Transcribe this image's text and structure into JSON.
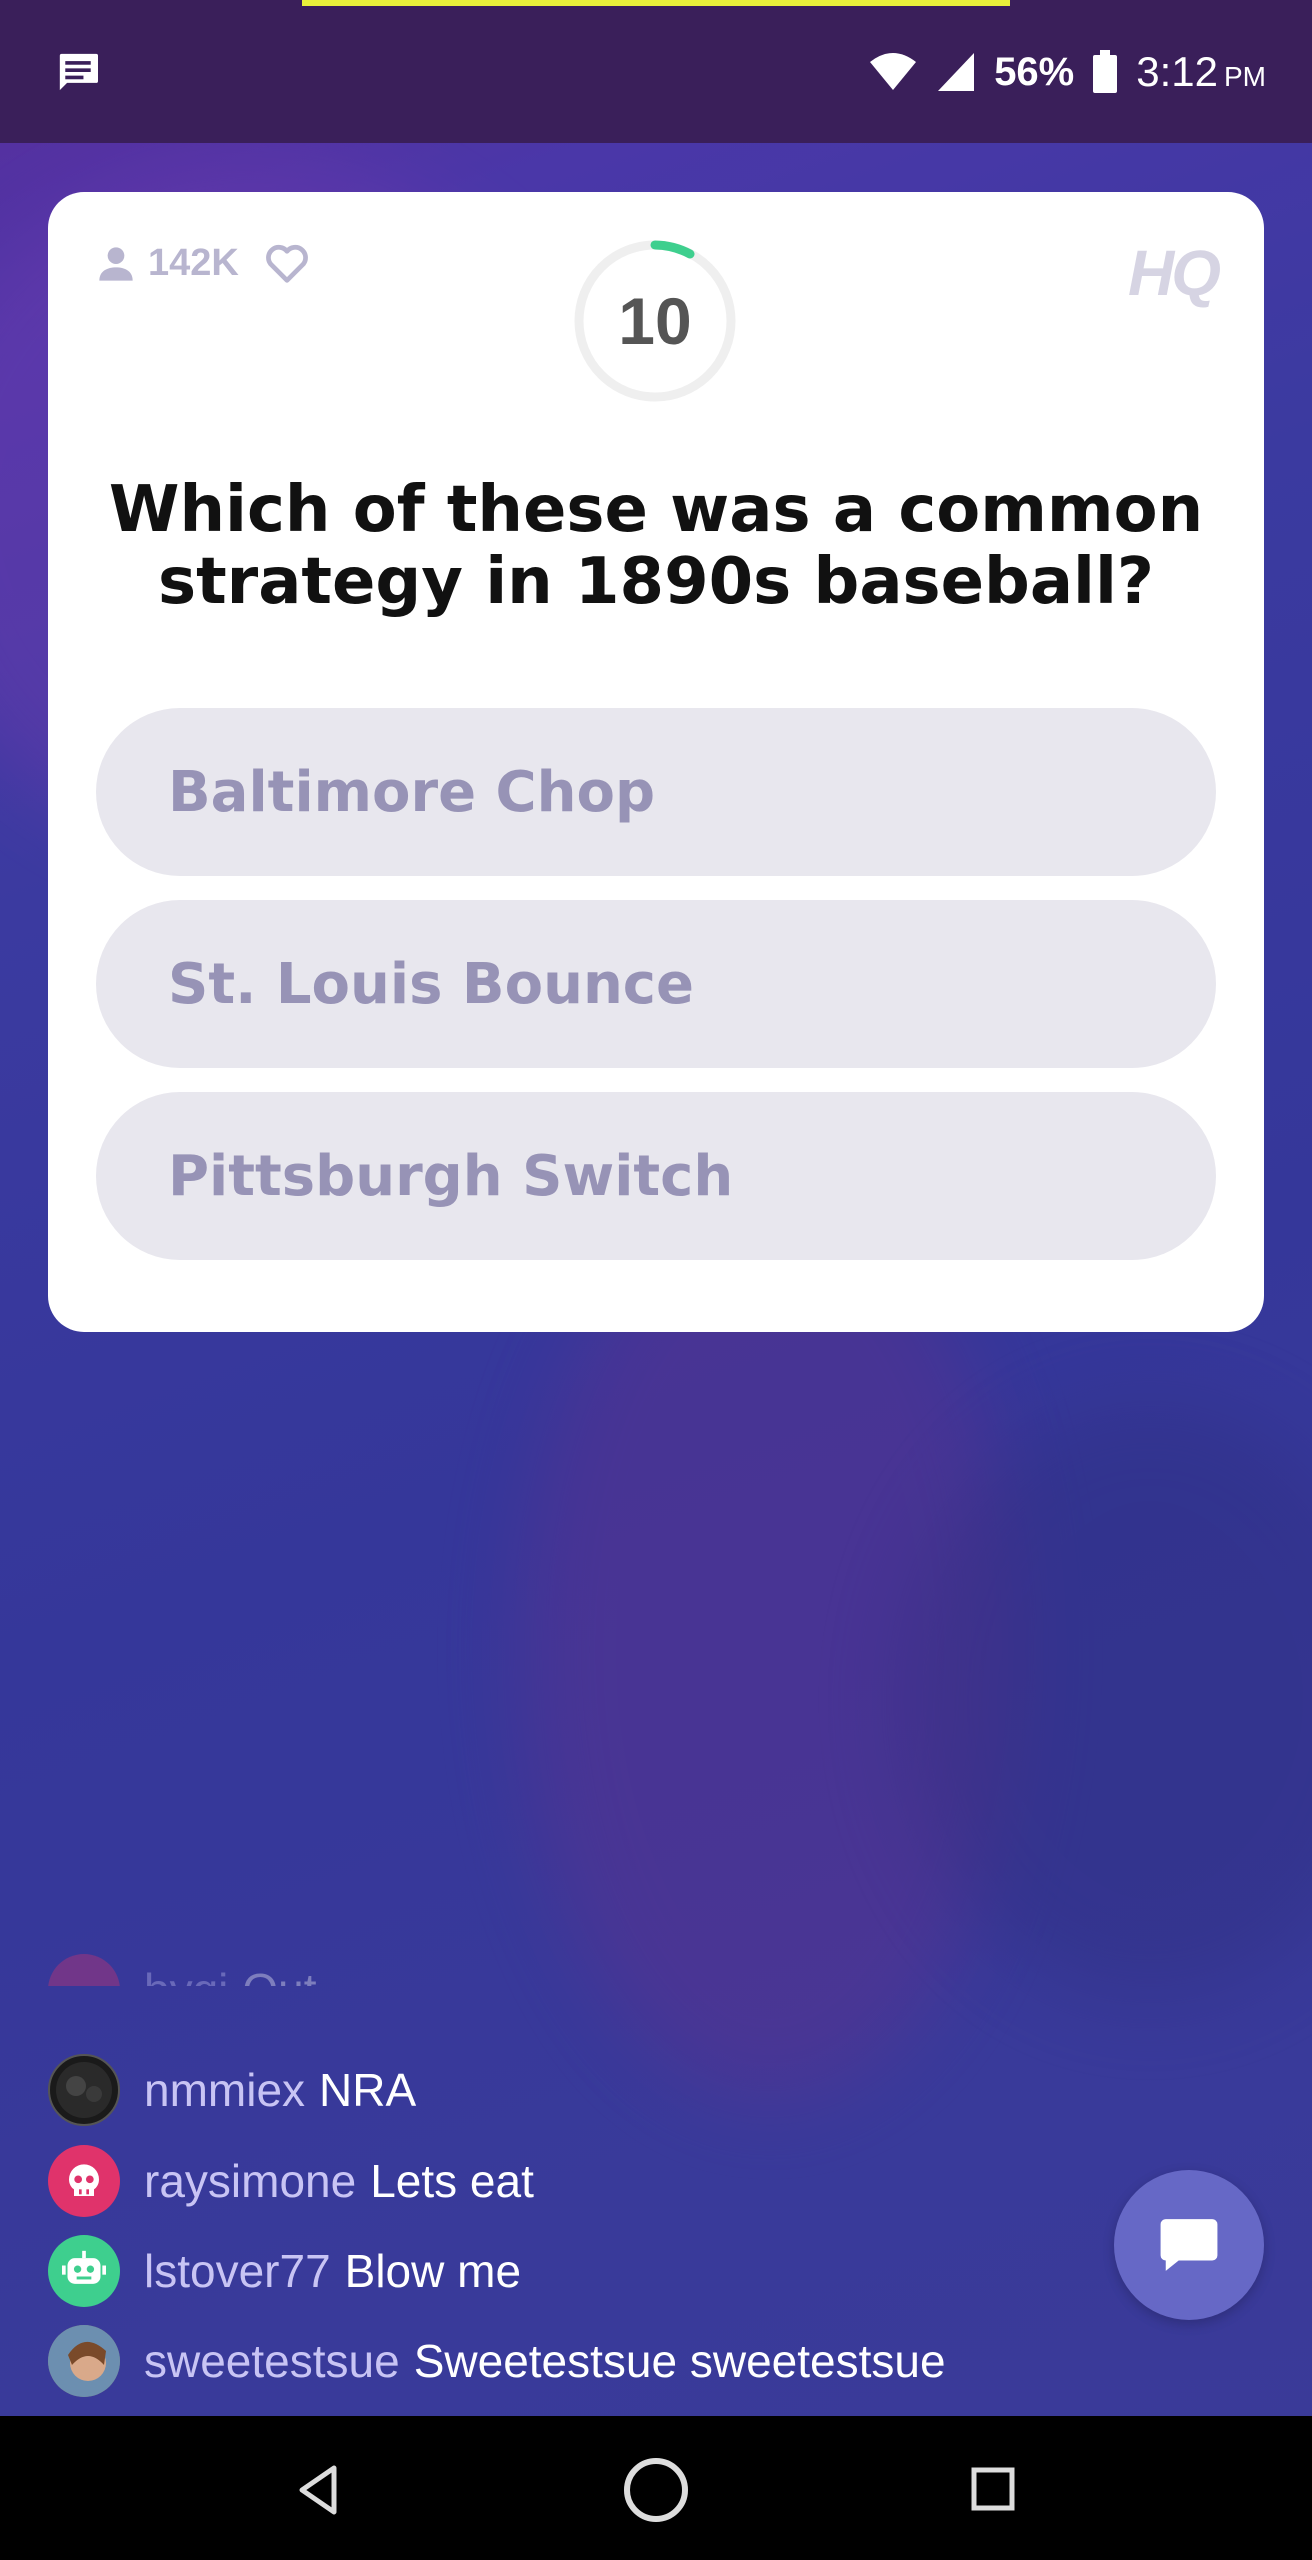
{
  "status_bar": {
    "battery_percent": "56%",
    "time": "3:12",
    "time_suffix": "PM"
  },
  "card": {
    "viewer_count": "142K",
    "timer": "10",
    "logo": "HQ",
    "question": "Which of these was a common strategy in 1890s baseball?",
    "answers": [
      "Baltimore Chop",
      "St. Louis Bounce",
      "Pittsburgh Switch"
    ]
  },
  "chat": {
    "messages": [
      {
        "user": "bygi",
        "message": "Out",
        "avatar_color": "#e0336b",
        "avatar_icon": "skull-icon"
      },
      {
        "user": "nmmiex",
        "message": "NRA",
        "avatar_color": "#222222",
        "avatar_icon": "photo-avatar"
      },
      {
        "user": "raysimone",
        "message": "Lets eat",
        "avatar_color": "#e0336b",
        "avatar_icon": "skull-icon"
      },
      {
        "user": "lstover77",
        "message": "Blow me",
        "avatar_color": "#3ecf8e",
        "avatar_icon": "robot-icon"
      },
      {
        "user": "sweetestsue",
        "message": "Sweetestsue sweetestsue",
        "avatar_color": "#b58a6a",
        "avatar_icon": "photo-avatar"
      }
    ]
  },
  "colors": {
    "accent_timer": "#3ecf8e",
    "answer_bg": "#e8e7ee",
    "answer_text": "#9793b6",
    "chat_button": "#6668c6"
  }
}
